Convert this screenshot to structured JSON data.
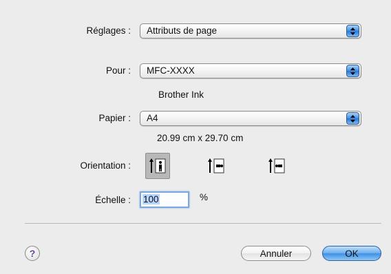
{
  "settings": {
    "label": "Réglages :",
    "value": "Attributs de page"
  },
  "format_for": {
    "label": "Pour :",
    "value": "MFC-XXXX",
    "subtitle": "Brother Ink"
  },
  "paper": {
    "label": "Papier :",
    "value": "A4",
    "dimensions": "20.99 cm x 29.70 cm"
  },
  "orientation": {
    "label": "Orientation :",
    "options": [
      {
        "icon": "portrait-icon",
        "selected": true
      },
      {
        "icon": "landscape-icon",
        "selected": false
      },
      {
        "icon": "reverse-landscape-icon",
        "selected": false
      }
    ]
  },
  "scale": {
    "label": "Échelle :",
    "value": "100",
    "unit": "%"
  },
  "buttons": {
    "help": "?",
    "cancel": "Annuler",
    "ok": "OK"
  },
  "colors": {
    "accent": "#3e8ee6",
    "background": "#ececec"
  }
}
